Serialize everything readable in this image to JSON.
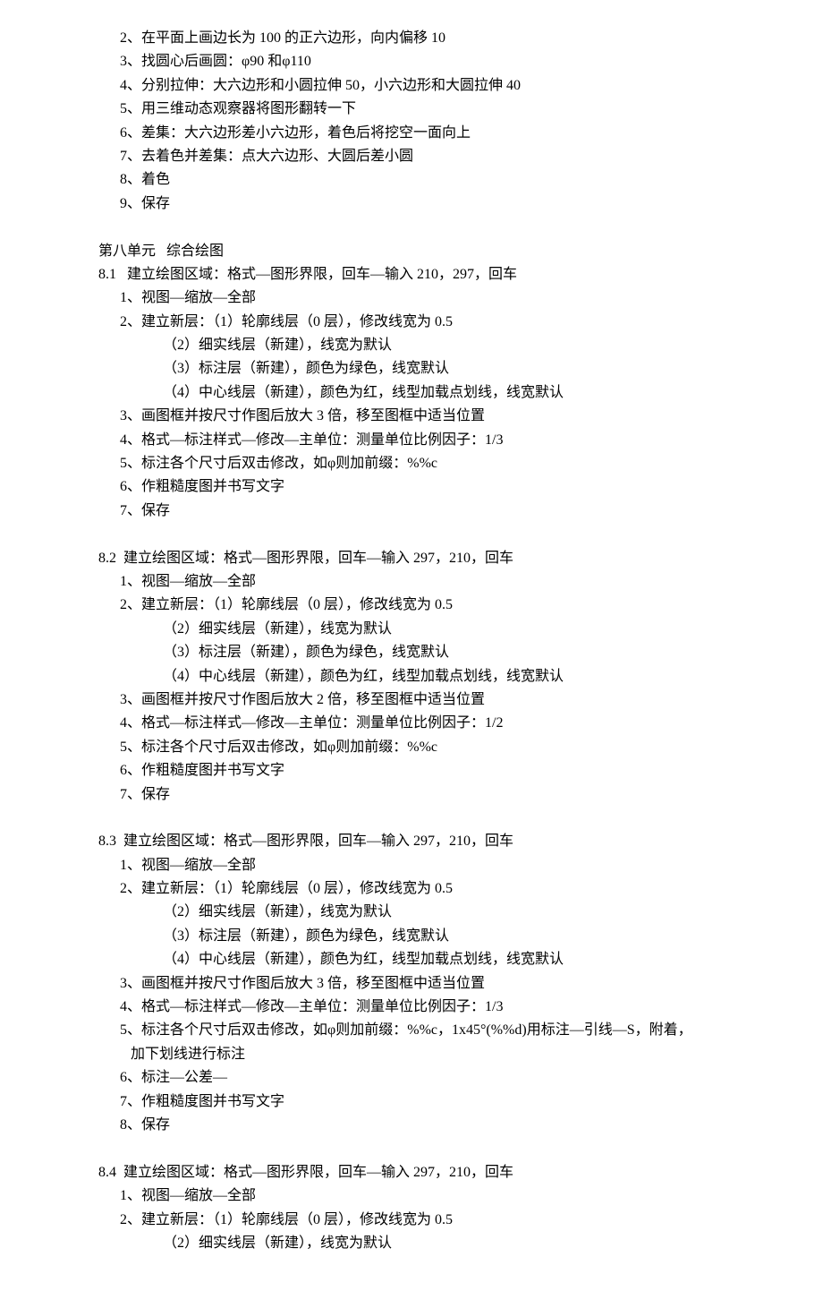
{
  "continuation_of_7": [
    "2、在平面上画边长为 100 的正六边形，向内偏移 10",
    "3、找圆心后画圆：φ90 和φ110",
    "4、分别拉伸：大六边形和小圆拉伸 50，小六边形和大圆拉伸 40",
    "5、用三维动态观察器将图形翻转一下",
    "6、差集：大六边形差小六边形，着色后将挖空一面向上",
    "7、去着色并差集：点大六边形、大圆后差小圆",
    "8、着色",
    "9、保存"
  ],
  "unit8_title": "第八单元   综合绘图",
  "section_8_1": {
    "heading": "8.1   建立绘图区域：格式—图形界限，回车—输入 210，297，回车",
    "items": [
      "1、视图—缩放—全部",
      "2、建立新层：（1）轮廓线层（0 层），修改线宽为 0.5",
      "            （2）细实线层（新建），线宽为默认",
      "            （3）标注层（新建），颜色为绿色，线宽默认",
      "            （4）中心线层（新建），颜色为红，线型加载点划线，线宽默认",
      "3、画图框并按尺寸作图后放大 3 倍，移至图框中适当位置",
      "4、格式—标注样式—修改—主单位：测量单位比例因子：1/3",
      "5、标注各个尺寸后双击修改，如φ则加前缀：%%c",
      "6、作粗糙度图并书写文字",
      "7、保存"
    ]
  },
  "section_8_2": {
    "heading": "8.2  建立绘图区域：格式—图形界限，回车—输入 297，210，回车",
    "items": [
      "1、视图—缩放—全部",
      "2、建立新层：（1）轮廓线层（0 层），修改线宽为 0.5",
      "            （2）细实线层（新建），线宽为默认",
      "            （3）标注层（新建），颜色为绿色，线宽默认",
      "            （4）中心线层（新建），颜色为红，线型加载点划线，线宽默认",
      "3、画图框并按尺寸作图后放大 2 倍，移至图框中适当位置",
      "4、格式—标注样式—修改—主单位：测量单位比例因子：1/2",
      "5、标注各个尺寸后双击修改，如φ则加前缀：%%c",
      "6、作粗糙度图并书写文字",
      "7、保存"
    ]
  },
  "section_8_3": {
    "heading": "8.3  建立绘图区域：格式—图形界限，回车—输入 297，210，回车",
    "items": [
      "1、视图—缩放—全部",
      "2、建立新层：（1）轮廓线层（0 层），修改线宽为 0.5",
      "            （2）细实线层（新建），线宽为默认",
      "            （3）标注层（新建），颜色为绿色，线宽默认",
      "            （4）中心线层（新建），颜色为红，线型加载点划线，线宽默认",
      "3、画图框并按尺寸作图后放大 3 倍，移至图框中适当位置",
      "4、格式—标注样式—修改—主单位：测量单位比例因子：1/3",
      "5、标注各个尺寸后双击修改，如φ则加前缀：%%c，1x45°(%%d)用标注—引线—S，附着，",
      "   加下划线进行标注",
      "6、标注—公差—",
      "7、作粗糙度图并书写文字",
      "8、保存"
    ]
  },
  "section_8_4": {
    "heading": "8.4  建立绘图区域：格式—图形界限，回车—输入 297，210，回车",
    "items": [
      "1、视图—缩放—全部",
      "2、建立新层：（1）轮廓线层（0 层），修改线宽为 0.5",
      "            （2）细实线层（新建），线宽为默认"
    ]
  },
  "indent": {
    "numbered": "      ",
    "sublist": "                  "
  }
}
